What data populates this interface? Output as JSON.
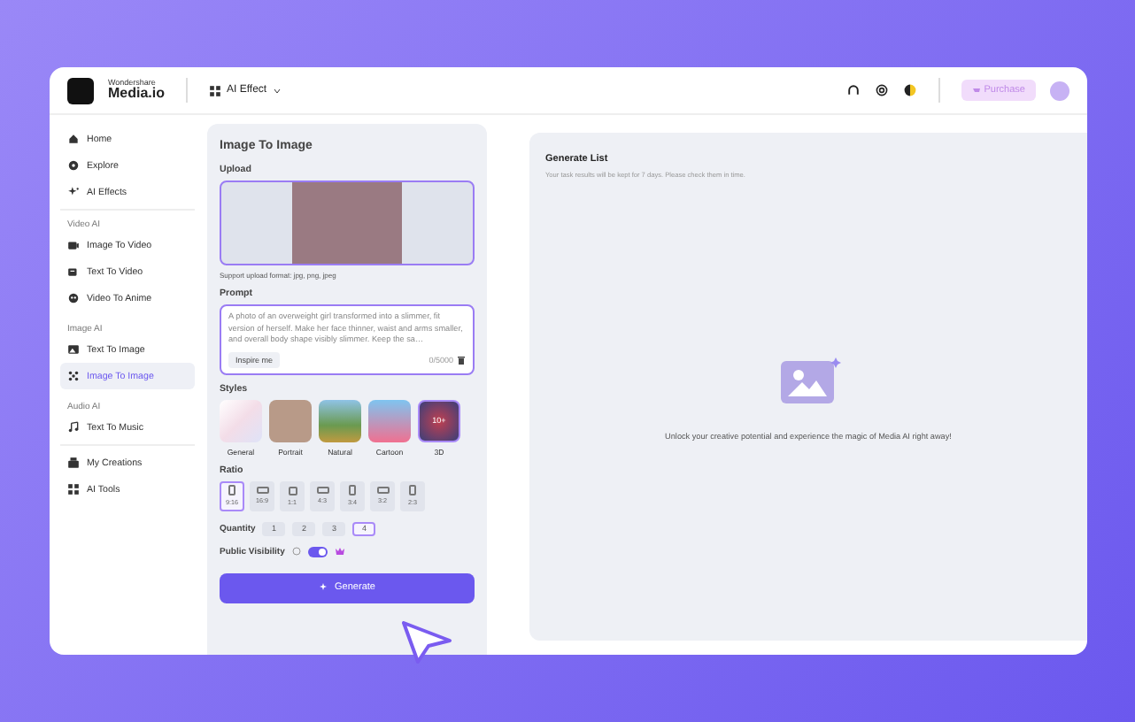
{
  "header": {
    "brand_small": "Wondershare",
    "brand": "Media.io",
    "menu": "AI Effect",
    "purchase": "Purchase"
  },
  "sidebar": [
    {
      "items": [
        {
          "label": "Home",
          "selected": false
        },
        {
          "label": "Explore",
          "selected": false
        },
        {
          "label": "AI Effects",
          "selected": false
        }
      ]
    },
    {
      "heading": "Video AI",
      "items": [
        {
          "label": "Image To Video",
          "selected": false
        },
        {
          "label": "Text To Video",
          "selected": false
        },
        {
          "label": "Video To Anime",
          "selected": false
        }
      ]
    },
    {
      "heading": "Image AI",
      "items": [
        {
          "label": "Text To Image",
          "selected": false
        },
        {
          "label": "Image To Image",
          "selected": true
        }
      ]
    },
    {
      "heading": "Audio AI",
      "items": [
        {
          "label": "Text To Music",
          "selected": false
        }
      ]
    },
    {
      "items": [
        {
          "label": "My Creations",
          "selected": false
        },
        {
          "label": "AI Tools",
          "selected": false
        }
      ]
    }
  ],
  "form": {
    "title": "Image To Image",
    "upload_label": "Upload",
    "upload_hint": "Support upload format: jpg, png, jpeg",
    "prompt_label": "Prompt",
    "prompt": "A photo of an overweight girl transformed into a slimmer, fit version of herself. Make her face thinner, waist and arms smaller, and overall body shape visibly slimmer. Keep the sa…",
    "inspire": "Inspire me",
    "counter": "0/5000",
    "styles_label": "Styles",
    "styles": [
      {
        "label": "General",
        "selected": false
      },
      {
        "label": "Portrait",
        "selected": false
      },
      {
        "label": "Natural",
        "selected": false
      },
      {
        "label": "Cartoon",
        "selected": false
      },
      {
        "label": "3D",
        "selected": true,
        "badge": "10+"
      }
    ],
    "ratio_label": "Ratio",
    "ratios": [
      {
        "label": "9:16",
        "kind": "tall",
        "selected": true
      },
      {
        "label": "16:9",
        "kind": "wide",
        "selected": false
      },
      {
        "label": "1:1",
        "kind": "square",
        "selected": false
      },
      {
        "label": "4:3",
        "kind": "wide",
        "selected": false
      },
      {
        "label": "3:4",
        "kind": "tall",
        "selected": false
      },
      {
        "label": "3:2",
        "kind": "wide",
        "selected": false
      },
      {
        "label": "2:3",
        "kind": "tall",
        "selected": false
      }
    ],
    "quantity_label": "Quantity",
    "quantities": [
      {
        "label": "1",
        "selected": false
      },
      {
        "label": "2",
        "selected": false
      },
      {
        "label": "3",
        "selected": false
      },
      {
        "label": "4",
        "selected": true
      }
    ],
    "visibility_label": "Public Visibility",
    "visibility_on": true,
    "generate": "Generate"
  },
  "results": {
    "title": "Generate List",
    "subtitle": "Your task results will be kept for 7 days. Please check them in time.",
    "empty": "Unlock your creative potential and experience the magic of Media AI right away!"
  }
}
